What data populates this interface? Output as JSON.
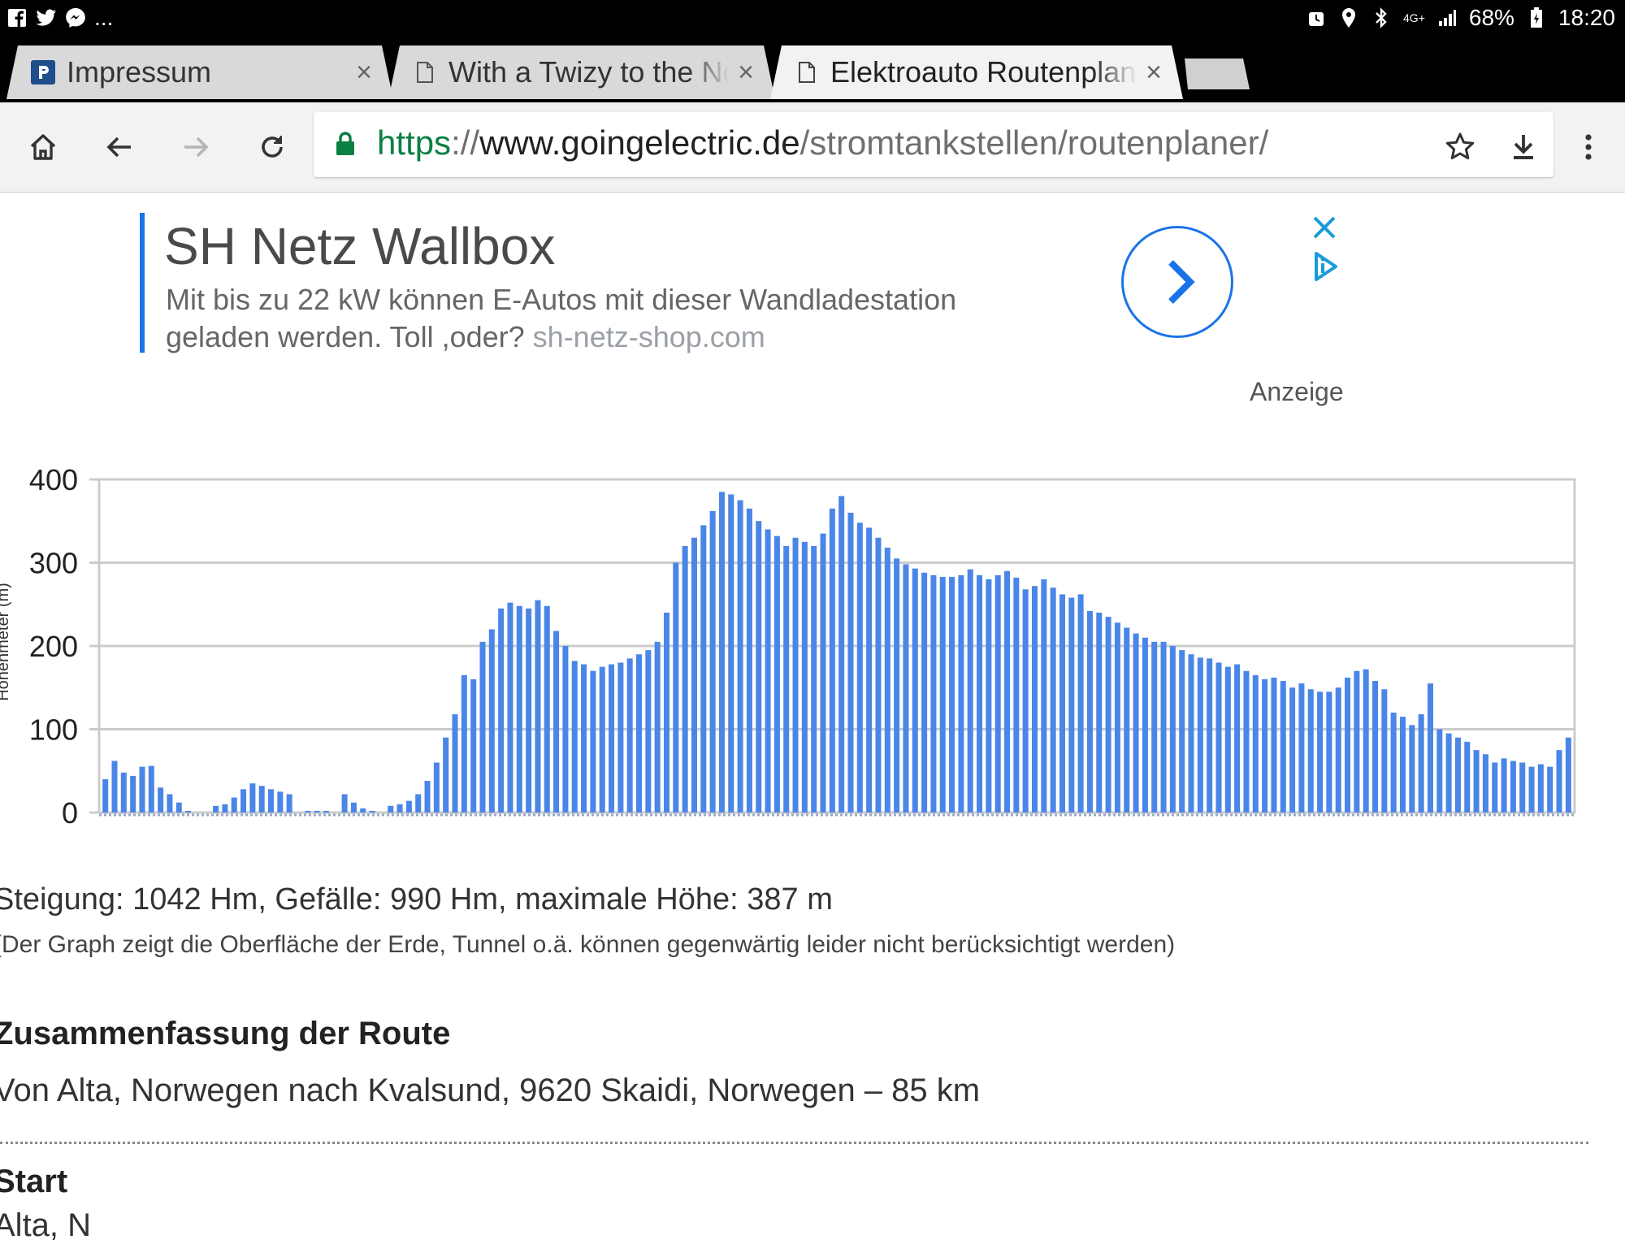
{
  "statusbar": {
    "more": "...",
    "battery": "68%",
    "time": "18:20",
    "network": "4G+"
  },
  "tabs": [
    {
      "title": "Impressum",
      "close": "×",
      "active": false
    },
    {
      "title": "With a Twizy to the North Cape",
      "close": "×",
      "active": false
    },
    {
      "title": "Elektroauto Routenplaner",
      "close": "×",
      "active": true
    }
  ],
  "omnibox": {
    "scheme": "https",
    "sep": "://",
    "host": "www.goingelectric.de",
    "path": "/stromtankstellen/routenplaner/"
  },
  "ad": {
    "title": "SH Netz Wallbox",
    "description": "Mit bis zu 22 kW können E-Autos mit dieser Wandladestation geladen werden. Toll ,oder?",
    "domain": "sh-netz-shop.com",
    "label": "Anzeige",
    "accent": "#1a73e8"
  },
  "chart_data": {
    "type": "bar",
    "ylabel": "Höhenmeter (m)",
    "ylim": [
      0,
      400
    ],
    "yticks": [
      "0",
      "100",
      "200",
      "300",
      "400"
    ],
    "grid": true,
    "color": "#4a86e8",
    "values": [
      40,
      62,
      48,
      44,
      55,
      56,
      30,
      22,
      12,
      2,
      0,
      0,
      8,
      10,
      18,
      28,
      35,
      32,
      28,
      25,
      22,
      0,
      2,
      2,
      2,
      0,
      22,
      12,
      5,
      2,
      0,
      8,
      10,
      14,
      22,
      38,
      60,
      90,
      118,
      165,
      160,
      205,
      220,
      245,
      252,
      248,
      245,
      255,
      248,
      218,
      200,
      182,
      178,
      170,
      175,
      178,
      180,
      185,
      190,
      195,
      205,
      240,
      300,
      320,
      330,
      345,
      362,
      385,
      382,
      375,
      365,
      350,
      340,
      332,
      320,
      330,
      325,
      320,
      335,
      365,
      380,
      360,
      348,
      342,
      330,
      318,
      305,
      298,
      293,
      288,
      285,
      283,
      283,
      285,
      292,
      285,
      280,
      285,
      290,
      282,
      268,
      272,
      280,
      270,
      262,
      258,
      262,
      242,
      240,
      235,
      228,
      222,
      215,
      210,
      205,
      205,
      200,
      195,
      190,
      186,
      185,
      180,
      175,
      178,
      170,
      165,
      160,
      162,
      158,
      150,
      155,
      148,
      145,
      145,
      150,
      162,
      170,
      172,
      158,
      148,
      120,
      115,
      105,
      118,
      155,
      100,
      95,
      90,
      85,
      75,
      70,
      60,
      65,
      62,
      60,
      55,
      58,
      55,
      75,
      90
    ]
  },
  "route": {
    "stats": "Steigung: 1042 Hm, Gefälle: 990 Hm, maximale Höhe: 387 m",
    "note": "(Der Graph zeigt die Oberfläche der Erde, Tunnel o.ä. können gegenwärtig leider nicht berücksichtigt werden)",
    "summary_heading": "Zusammenfassung der Route",
    "summary_text": "Von Alta, Norwegen nach Kvalsund, 9620 Skaidi, Norwegen – 85 km",
    "start_heading": "Start",
    "start_text": "Alta, N"
  }
}
